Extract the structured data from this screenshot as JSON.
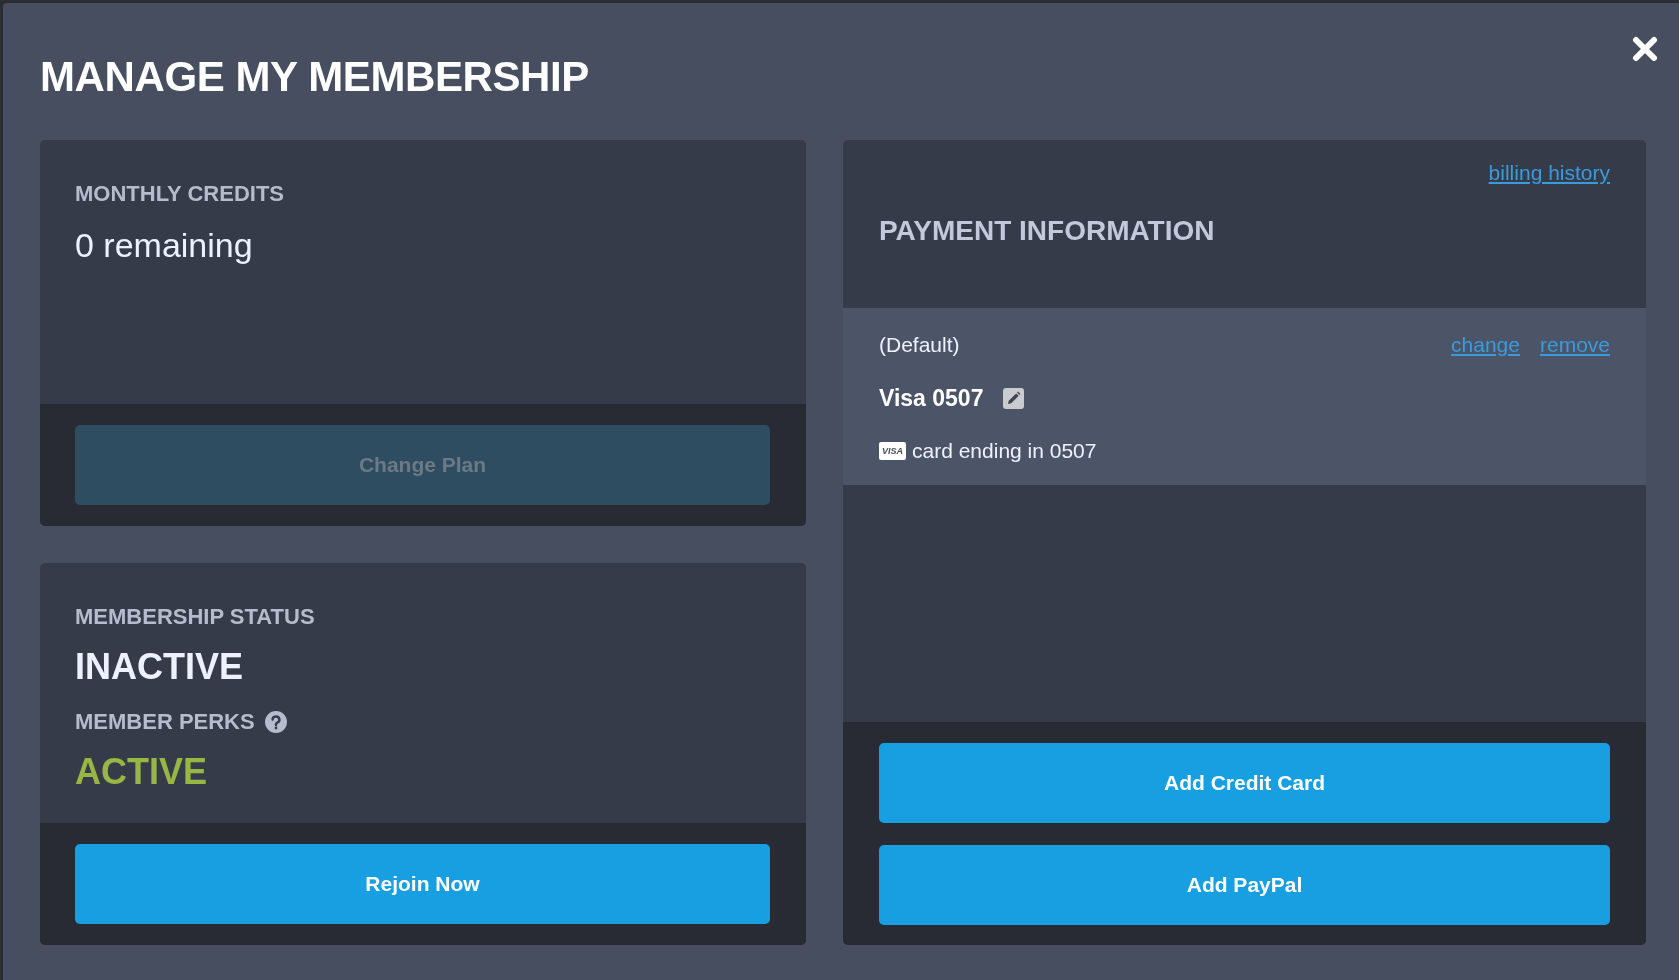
{
  "title": "MANAGE MY MEMBERSHIP",
  "credits": {
    "label": "MONTHLY CREDITS",
    "value": "0 remaining",
    "button": {
      "label": "Change Plan",
      "disabled": true
    }
  },
  "membership": {
    "sections": [
      {
        "label": "MEMBERSHIP STATUS",
        "value": "INACTIVE",
        "active": false,
        "help": false
      },
      {
        "label": "MEMBER PERKS",
        "value": "ACTIVE",
        "active": true,
        "help": true
      }
    ],
    "button": {
      "label": "Rejoin Now",
      "disabled": false
    }
  },
  "payment": {
    "link": "billing history",
    "title": "PAYMENT INFORMATION",
    "methods": [
      {
        "tag": "(Default)",
        "actions": [
          "change",
          "remove"
        ],
        "name": "Visa 0507",
        "badge": "VISA",
        "detail": "card ending in 0507"
      }
    ],
    "buttons": [
      {
        "label": "Add Credit Card",
        "disabled": false
      },
      {
        "label": "Add PayPal",
        "disabled": false
      }
    ]
  }
}
